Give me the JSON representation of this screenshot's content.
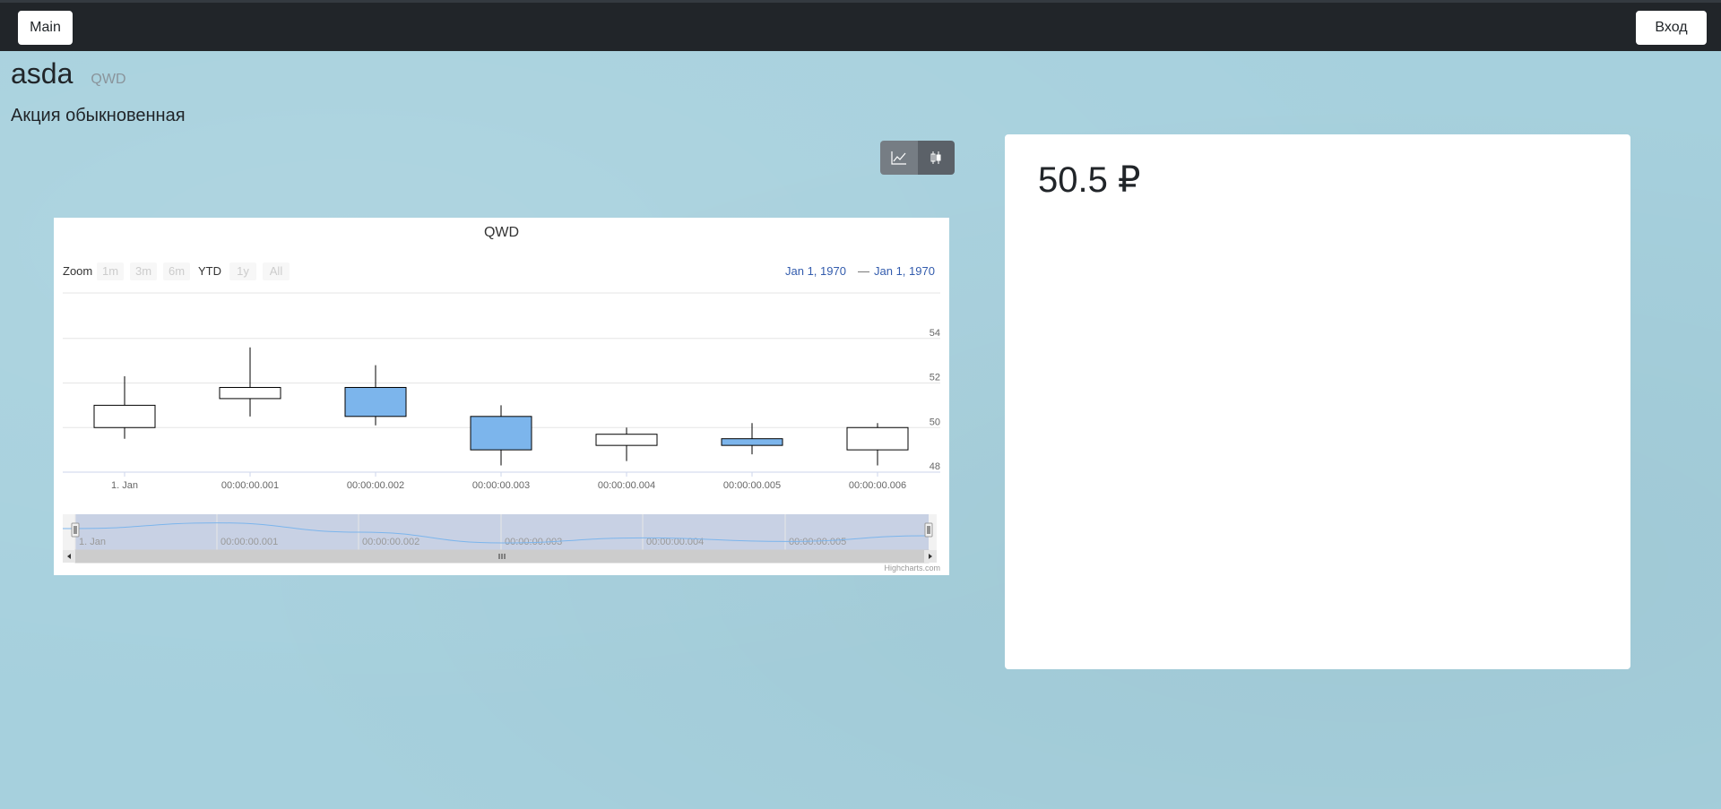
{
  "navbar": {
    "main_label": "Main",
    "login_label": "Вход"
  },
  "security": {
    "name": "asda",
    "ticker": "QWD",
    "type": "Акция обыкновенная"
  },
  "chart_toggle": {
    "options": [
      {
        "icon": "line-chart-icon"
      },
      {
        "icon": "candlestick-icon",
        "active": true
      }
    ]
  },
  "chart": {
    "zoom_label": "Zoom",
    "zoom_buttons": [
      "1m",
      "3m",
      "6m",
      "YTD",
      "1y",
      "All"
    ],
    "zoom_active": "YTD",
    "range_from": "Jan 1, 1970",
    "range_dash": "—",
    "range_to": "Jan 1, 1970",
    "credits": "Highcharts.com"
  },
  "chart_data": {
    "type": "candlestick",
    "title": "QWD",
    "categories": [
      "1. Jan",
      "00:00:00.001",
      "00:00:00.002",
      "00:00:00.003",
      "00:00:00.004",
      "00:00:00.005",
      "00:00:00.006"
    ],
    "navigator_labels": [
      "1. Jan",
      "00:00:00.001",
      "00:00:00.002",
      "00:00:00.003",
      "00:00:00.004",
      "00:00:00.005"
    ],
    "ohlc": [
      {
        "open": 50.0,
        "high": 52.3,
        "low": 49.5,
        "close": 51.0
      },
      {
        "open": 51.3,
        "high": 53.6,
        "low": 50.5,
        "close": 51.8
      },
      {
        "open": 51.8,
        "high": 52.8,
        "low": 50.1,
        "close": 50.5
      },
      {
        "open": 50.5,
        "high": 51.0,
        "low": 48.3,
        "close": 49.0
      },
      {
        "open": 49.2,
        "high": 50.0,
        "low": 48.5,
        "close": 49.7
      },
      {
        "open": 49.5,
        "high": 50.2,
        "low": 48.8,
        "close": 49.2
      },
      {
        "open": 49.0,
        "high": 50.2,
        "low": 48.3,
        "close": 50.0
      }
    ],
    "y_ticks": [
      48,
      50,
      52,
      54
    ],
    "ylim": [
      48,
      56
    ],
    "colors": {
      "up": "#ffffff",
      "down": "#7cb5ec",
      "line": "#000000"
    }
  },
  "price": {
    "value": "50.5 ₽"
  }
}
